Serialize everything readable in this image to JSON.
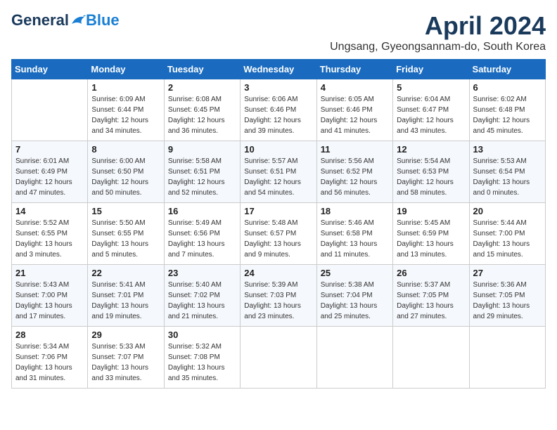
{
  "logo": {
    "general": "General",
    "blue": "Blue"
  },
  "title": {
    "month": "April 2024",
    "location": "Ungsang, Gyeongsannam-do, South Korea"
  },
  "weekdays": [
    "Sunday",
    "Monday",
    "Tuesday",
    "Wednesday",
    "Thursday",
    "Friday",
    "Saturday"
  ],
  "weeks": [
    [
      {
        "day": "",
        "info": ""
      },
      {
        "day": "1",
        "info": "Sunrise: 6:09 AM\nSunset: 6:44 PM\nDaylight: 12 hours\nand 34 minutes."
      },
      {
        "day": "2",
        "info": "Sunrise: 6:08 AM\nSunset: 6:45 PM\nDaylight: 12 hours\nand 36 minutes."
      },
      {
        "day": "3",
        "info": "Sunrise: 6:06 AM\nSunset: 6:46 PM\nDaylight: 12 hours\nand 39 minutes."
      },
      {
        "day": "4",
        "info": "Sunrise: 6:05 AM\nSunset: 6:46 PM\nDaylight: 12 hours\nand 41 minutes."
      },
      {
        "day": "5",
        "info": "Sunrise: 6:04 AM\nSunset: 6:47 PM\nDaylight: 12 hours\nand 43 minutes."
      },
      {
        "day": "6",
        "info": "Sunrise: 6:02 AM\nSunset: 6:48 PM\nDaylight: 12 hours\nand 45 minutes."
      }
    ],
    [
      {
        "day": "7",
        "info": "Sunrise: 6:01 AM\nSunset: 6:49 PM\nDaylight: 12 hours\nand 47 minutes."
      },
      {
        "day": "8",
        "info": "Sunrise: 6:00 AM\nSunset: 6:50 PM\nDaylight: 12 hours\nand 50 minutes."
      },
      {
        "day": "9",
        "info": "Sunrise: 5:58 AM\nSunset: 6:51 PM\nDaylight: 12 hours\nand 52 minutes."
      },
      {
        "day": "10",
        "info": "Sunrise: 5:57 AM\nSunset: 6:51 PM\nDaylight: 12 hours\nand 54 minutes."
      },
      {
        "day": "11",
        "info": "Sunrise: 5:56 AM\nSunset: 6:52 PM\nDaylight: 12 hours\nand 56 minutes."
      },
      {
        "day": "12",
        "info": "Sunrise: 5:54 AM\nSunset: 6:53 PM\nDaylight: 12 hours\nand 58 minutes."
      },
      {
        "day": "13",
        "info": "Sunrise: 5:53 AM\nSunset: 6:54 PM\nDaylight: 13 hours\nand 0 minutes."
      }
    ],
    [
      {
        "day": "14",
        "info": "Sunrise: 5:52 AM\nSunset: 6:55 PM\nDaylight: 13 hours\nand 3 minutes."
      },
      {
        "day": "15",
        "info": "Sunrise: 5:50 AM\nSunset: 6:55 PM\nDaylight: 13 hours\nand 5 minutes."
      },
      {
        "day": "16",
        "info": "Sunrise: 5:49 AM\nSunset: 6:56 PM\nDaylight: 13 hours\nand 7 minutes."
      },
      {
        "day": "17",
        "info": "Sunrise: 5:48 AM\nSunset: 6:57 PM\nDaylight: 13 hours\nand 9 minutes."
      },
      {
        "day": "18",
        "info": "Sunrise: 5:46 AM\nSunset: 6:58 PM\nDaylight: 13 hours\nand 11 minutes."
      },
      {
        "day": "19",
        "info": "Sunrise: 5:45 AM\nSunset: 6:59 PM\nDaylight: 13 hours\nand 13 minutes."
      },
      {
        "day": "20",
        "info": "Sunrise: 5:44 AM\nSunset: 7:00 PM\nDaylight: 13 hours\nand 15 minutes."
      }
    ],
    [
      {
        "day": "21",
        "info": "Sunrise: 5:43 AM\nSunset: 7:00 PM\nDaylight: 13 hours\nand 17 minutes."
      },
      {
        "day": "22",
        "info": "Sunrise: 5:41 AM\nSunset: 7:01 PM\nDaylight: 13 hours\nand 19 minutes."
      },
      {
        "day": "23",
        "info": "Sunrise: 5:40 AM\nSunset: 7:02 PM\nDaylight: 13 hours\nand 21 minutes."
      },
      {
        "day": "24",
        "info": "Sunrise: 5:39 AM\nSunset: 7:03 PM\nDaylight: 13 hours\nand 23 minutes."
      },
      {
        "day": "25",
        "info": "Sunrise: 5:38 AM\nSunset: 7:04 PM\nDaylight: 13 hours\nand 25 minutes."
      },
      {
        "day": "26",
        "info": "Sunrise: 5:37 AM\nSunset: 7:05 PM\nDaylight: 13 hours\nand 27 minutes."
      },
      {
        "day": "27",
        "info": "Sunrise: 5:36 AM\nSunset: 7:05 PM\nDaylight: 13 hours\nand 29 minutes."
      }
    ],
    [
      {
        "day": "28",
        "info": "Sunrise: 5:34 AM\nSunset: 7:06 PM\nDaylight: 13 hours\nand 31 minutes."
      },
      {
        "day": "29",
        "info": "Sunrise: 5:33 AM\nSunset: 7:07 PM\nDaylight: 13 hours\nand 33 minutes."
      },
      {
        "day": "30",
        "info": "Sunrise: 5:32 AM\nSunset: 7:08 PM\nDaylight: 13 hours\nand 35 minutes."
      },
      {
        "day": "",
        "info": ""
      },
      {
        "day": "",
        "info": ""
      },
      {
        "day": "",
        "info": ""
      },
      {
        "day": "",
        "info": ""
      }
    ]
  ]
}
